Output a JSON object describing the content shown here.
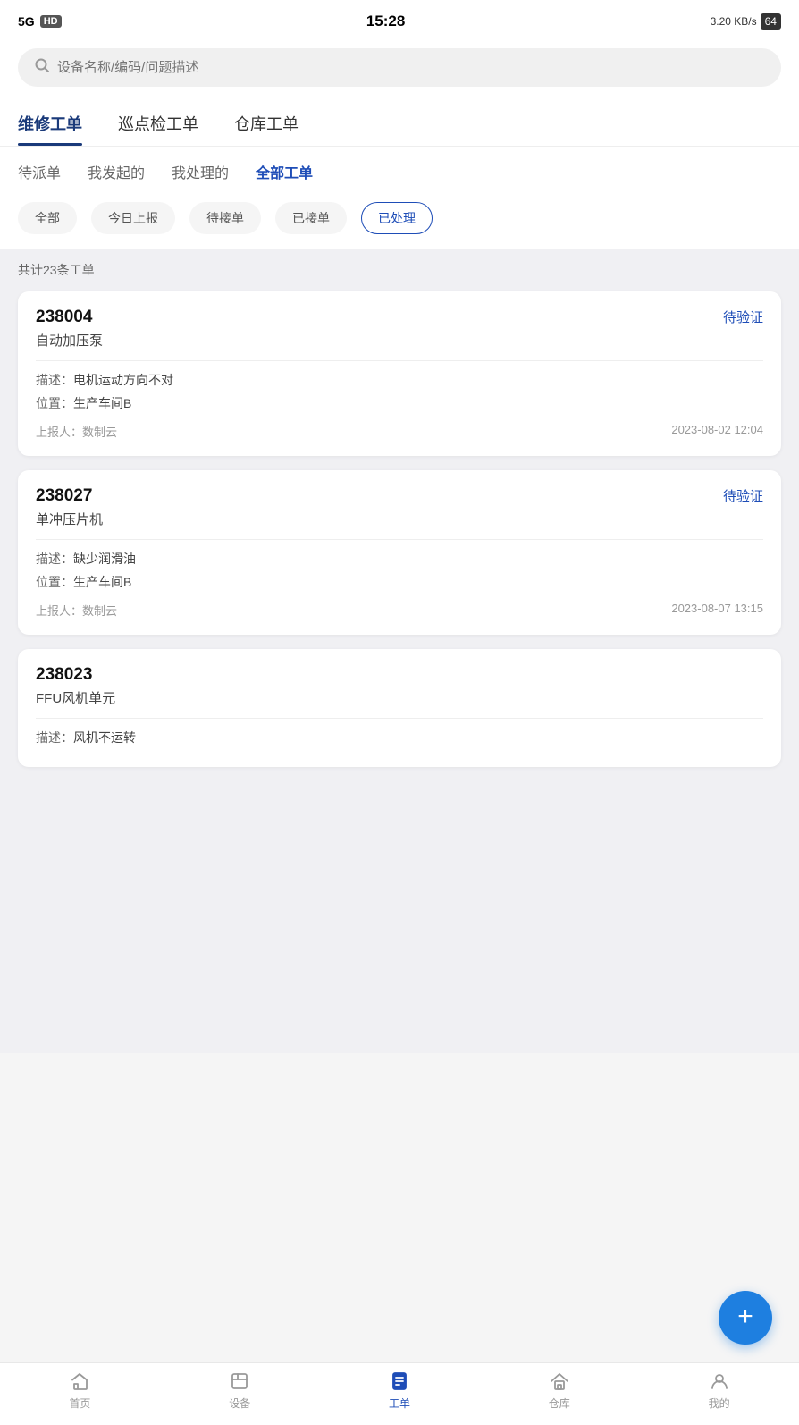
{
  "statusBar": {
    "signal": "5G",
    "hd": "HD",
    "time": "15:28",
    "speed": "3.20 KB/s",
    "battery": "64"
  },
  "search": {
    "placeholder": "设备名称/编码/问题描述"
  },
  "mainTabs": [
    {
      "label": "维修工单",
      "active": true
    },
    {
      "label": "巡点检工单",
      "active": false
    },
    {
      "label": "仓库工单",
      "active": false
    }
  ],
  "subTabs": [
    {
      "label": "待派单",
      "active": false
    },
    {
      "label": "我发起的",
      "active": false
    },
    {
      "label": "我处理的",
      "active": false
    },
    {
      "label": "全部工单",
      "active": true
    }
  ],
  "filterTabs": [
    {
      "label": "全部",
      "active": false
    },
    {
      "label": "今日上报",
      "active": false
    },
    {
      "label": "待接单",
      "active": false
    },
    {
      "label": "已接单",
      "active": false
    },
    {
      "label": "已处理",
      "active": true
    }
  ],
  "listCount": "共计23条工单",
  "workOrders": [
    {
      "id": "238004",
      "status": "待验证",
      "device": "自动加压泵",
      "description": "电机运动方向不对",
      "location": "生产车间B",
      "reporter": "数制云",
      "time": "2023-08-02 12:04"
    },
    {
      "id": "238027",
      "status": "待验证",
      "device": "单冲压片机",
      "description": "缺少润滑油",
      "location": "生产车间B",
      "reporter": "数制云",
      "time": "2023-08-07 13:15"
    },
    {
      "id": "238023",
      "status": "",
      "device": "FFU风机单元",
      "description": "风机不运转",
      "location": "",
      "reporter": "",
      "time": ""
    }
  ],
  "labels": {
    "description": "描述：",
    "location": "位置：",
    "reporter": "上报人："
  },
  "bottomNav": [
    {
      "label": "首页",
      "icon": "home",
      "active": false
    },
    {
      "label": "设备",
      "icon": "device",
      "active": false
    },
    {
      "label": "工单",
      "icon": "workorder",
      "active": true
    },
    {
      "label": "仓库",
      "icon": "warehouse",
      "active": false
    },
    {
      "label": "我的",
      "icon": "profile",
      "active": false
    }
  ]
}
